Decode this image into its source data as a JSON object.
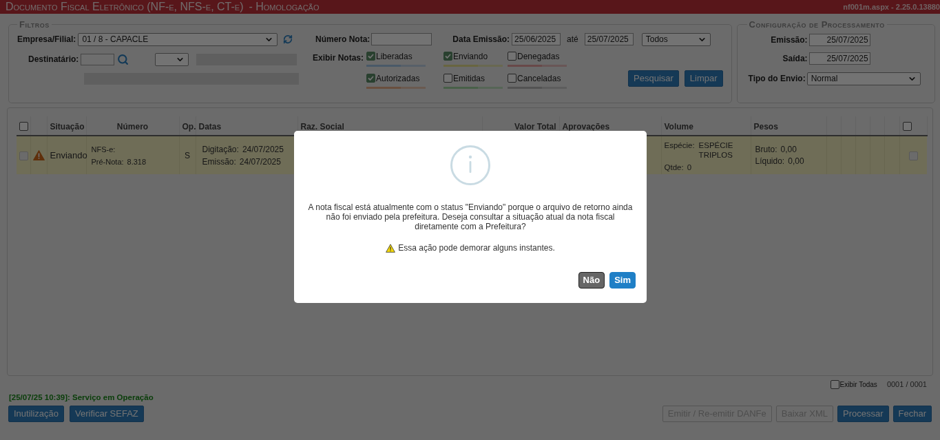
{
  "window": {
    "title": "Documento Fiscal Eletrônico (NF-e, NFS-e, CT-e)",
    "environment": "- Homologação",
    "version": "nf001m.aspx - 2.25.0.13880"
  },
  "filters": {
    "legend": "Filtros",
    "empresa": {
      "label": "Empresa/Filial:",
      "value": "01 / 8 - CAPACLE"
    },
    "destinatario": {
      "label": "Destinatário:"
    },
    "numero_nota": {
      "label": "Número Nota:"
    },
    "data_emissao": {
      "label": "Data Emissão:",
      "from": "25/06/2025",
      "to_label": "até",
      "to": "25/07/2025",
      "mode": "Todos"
    },
    "exibir_notas": {
      "label": "Exibir Notas:",
      "options": [
        {
          "label": "Liberadas",
          "checked": true,
          "color": "#495968"
        },
        {
          "label": "Enviando",
          "checked": true,
          "color": "#686540"
        },
        {
          "label": "Denegadas",
          "checked": false,
          "color": "#684848"
        },
        {
          "label": "Autorizadas",
          "checked": true,
          "color": "#694f3e"
        },
        {
          "label": "Emitidas",
          "checked": false,
          "color": "#486048"
        },
        {
          "label": "Canceladas",
          "checked": false,
          "color": "#535353"
        }
      ]
    },
    "buttons": [
      "Pesquisar",
      "Limpar"
    ]
  },
  "config": {
    "legend": "Configuração de Processamento",
    "emissao": {
      "label": "Emissão:",
      "value": "25/07/2025"
    },
    "saida": {
      "label": "Saída:",
      "value": "25/07/2025"
    },
    "tipo_envio": {
      "label": "Tipo do Envio:",
      "value": "Normal"
    }
  },
  "table": {
    "columns": [
      {
        "kind": "check",
        "checked": false
      },
      {
        "kind": "blank"
      },
      {
        "kind": "left",
        "label": "Situação"
      },
      {
        "kind": "center",
        "label": "Número"
      },
      {
        "kind": "left",
        "label": "Op."
      },
      {
        "kind": "left",
        "label": "Datas"
      },
      {
        "kind": "left",
        "label": "Raz. Social"
      },
      {
        "kind": "right",
        "label": "Valor Total"
      },
      {
        "kind": "left",
        "label": "Aprovações"
      },
      {
        "kind": "left",
        "label": "Volume"
      },
      {
        "kind": "left",
        "label": "Pesos"
      },
      {
        "kind": "blank"
      },
      {
        "kind": "blank"
      },
      {
        "kind": "blank"
      },
      {
        "kind": "blank"
      },
      {
        "kind": "blank"
      },
      {
        "kind": "check",
        "checked": false
      }
    ],
    "rows": [
      {
        "checkbox": {
          "checked": false,
          "disabled": true
        },
        "status_icon": {
          "kind": "warning"
        },
        "situacao": "Enviando",
        "numero": [
          {
            "label": "NFS-e:"
          },
          {
            "label": "Pré-Nota:",
            "value": "8.318"
          }
        ],
        "op": "S",
        "datas": [
          {
            "label": "Digitação:",
            "value": "24/07/2025"
          },
          {
            "label": "Emissão:",
            "value": "24/07/2025"
          }
        ],
        "volume": {
          "especie_label": "Espécie:",
          "especie": "ESPÉCIE TRIPLOS",
          "qtde_label": "Qtde:",
          "qtde": "0"
        },
        "pesos": [
          {
            "label": "Bruto:",
            "value": "0,00"
          },
          {
            "label": "Líquido:",
            "value": "0,00"
          }
        ],
        "end_checkbox": {
          "checked": false,
          "disabled": true
        }
      }
    ]
  },
  "grid_footer": {
    "exibir_todas": {
      "label": "Exibir Todas",
      "checked": false
    },
    "pages": "0001 / 0001"
  },
  "status_message": "[25/07/25 10:39]: Serviço em Operação",
  "left_buttons": [
    {
      "label": "Inutilização",
      "disabled": false
    },
    {
      "label": "Verificar SEFAZ",
      "disabled": false
    }
  ],
  "right_buttons": [
    {
      "label": "Emitir / Re-emitir DANFe",
      "disabled": true
    },
    {
      "label": "Baixar XML",
      "disabled": true
    },
    {
      "label": "Processar",
      "disabled": false
    },
    {
      "label": "Fechar",
      "disabled": false
    }
  ],
  "dialog": {
    "message": "A nota fiscal está atualmente com o status \"Enviando\" porque o arquivo de retorno ainda não foi enviado pela prefeitura. Deseja consultar a situação atual da nota fiscal diretamente com a Prefeitura?",
    "warning": "Essa ação pode demorar alguns instantes.",
    "buttons": [
      {
        "label": "Não",
        "kind": "secondary"
      },
      {
        "label": "Sim",
        "kind": "primary"
      }
    ]
  }
}
